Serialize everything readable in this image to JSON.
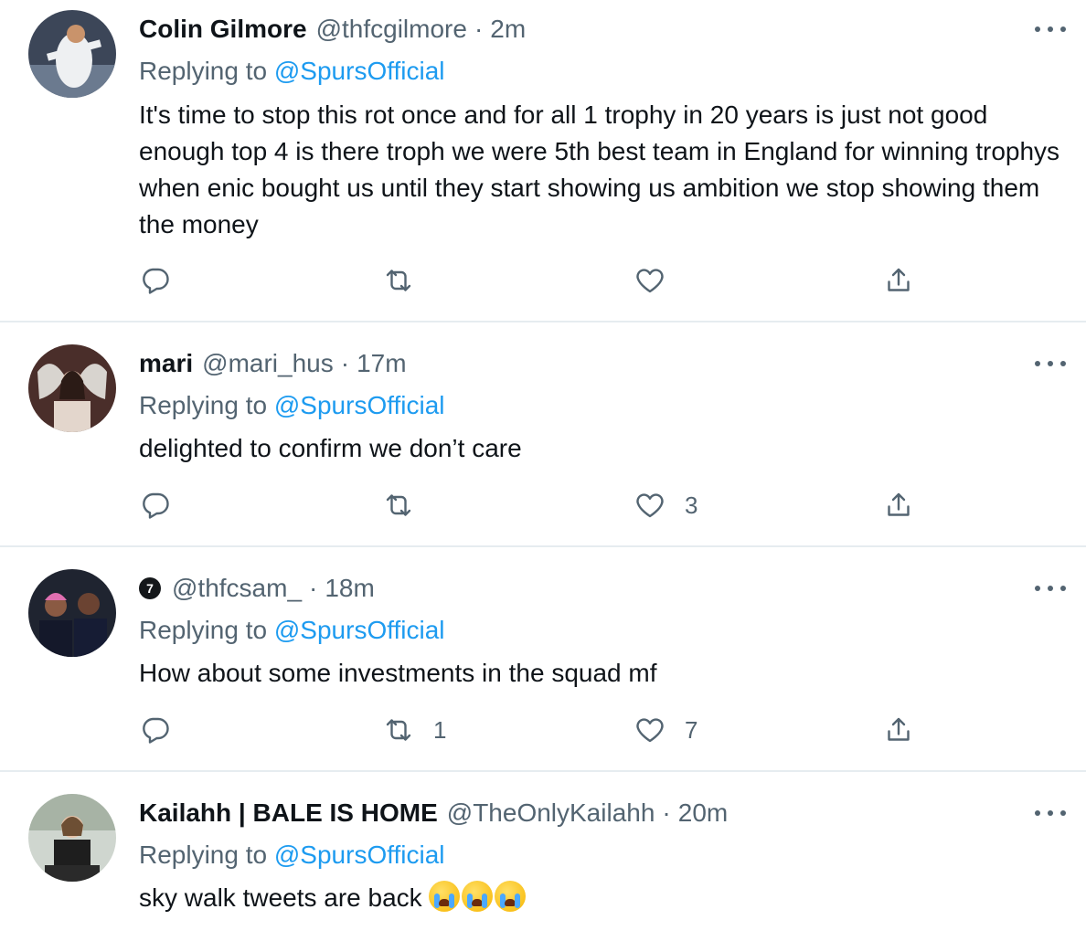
{
  "replying_prefix": "Replying to",
  "tweets": [
    {
      "name": "Colin Gilmore",
      "handle": "@thfcgilmore",
      "sep": "·",
      "time": "2m",
      "reply_to": "@SpursOfficial",
      "text": "It's time to stop this rot once and for all 1 trophy in 20 years is just not good enough top 4 is there troph we were 5th best team in England for winning trophys when enic bought us until they start showing us ambition we stop showing them the money",
      "replies": "",
      "retweets": "",
      "likes": ""
    },
    {
      "name": "mari",
      "handle": "@mari_hus",
      "sep": "·",
      "time": "17m",
      "reply_to": "@SpursOfficial",
      "text": "delighted to confirm we don’t care",
      "replies": "",
      "retweets": "",
      "likes": "3"
    },
    {
      "name": "",
      "badge": "7",
      "handle": "@thfcsam_",
      "sep": "·",
      "time": "18m",
      "reply_to": "@SpursOfficial",
      "text": "How about some investments in the squad mf",
      "replies": "",
      "retweets": "1",
      "likes": "7"
    },
    {
      "name": "Kailahh | BALE IS HOME",
      "handle": "@TheOnlyKailahh",
      "sep": "·",
      "time": "20m",
      "reply_to": "@SpursOfficial",
      "text": "sky walk tweets are back",
      "emoji": "loudly-crying-face x3"
    }
  ],
  "colors": {
    "link": "#1d9bf0",
    "secondary_text": "#536471",
    "divider": "#e6ecf0"
  },
  "icons": {
    "reply": "reply-icon",
    "retweet": "retweet-icon",
    "like": "heart-icon",
    "share": "share-icon",
    "more": "more-icon"
  }
}
